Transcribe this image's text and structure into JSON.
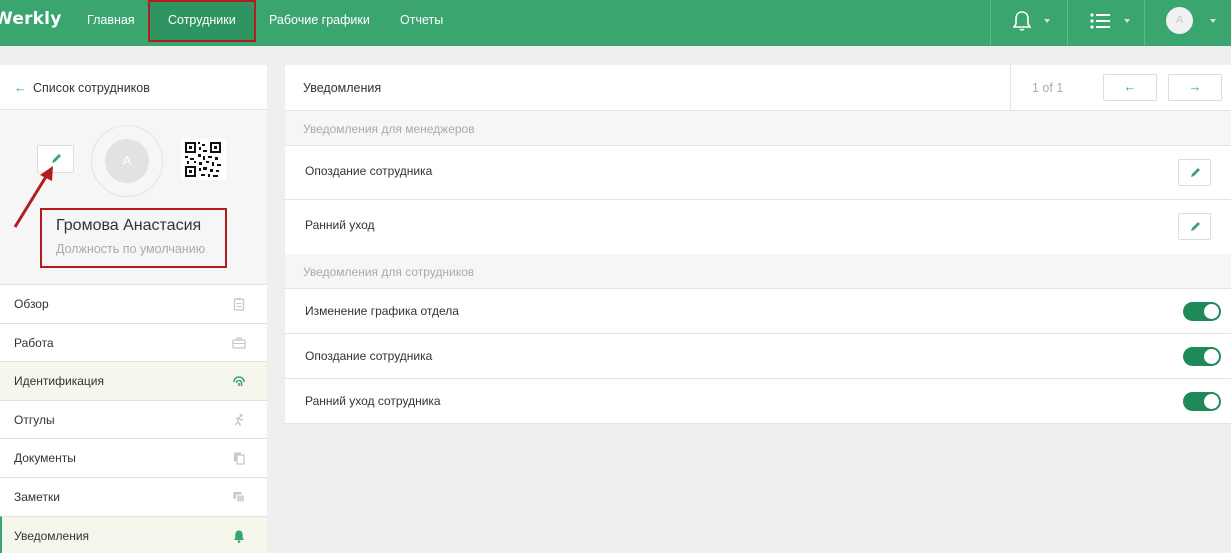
{
  "app": {
    "logo_text": "Werkly"
  },
  "nav": {
    "items": [
      {
        "label": "Главная"
      },
      {
        "label": "Сотрудники",
        "active": true
      },
      {
        "label": "Рабочие графики"
      },
      {
        "label": "Отчеты"
      }
    ]
  },
  "topbar": {
    "notifications_icon": "bell-icon",
    "list_icon": "list-icon",
    "avatar_letter": "A"
  },
  "sidebar": {
    "back_label": "Список сотрудников",
    "profile": {
      "avatar_letter": "А",
      "name": "Громова Анастасия",
      "position": "Должность по умолчанию"
    },
    "menu": [
      {
        "label": "Обзор",
        "icon": "clipboard-icon"
      },
      {
        "label": "Работа",
        "icon": "briefcase-icon"
      },
      {
        "label": "Идентификация",
        "icon": "fingerprint-icon",
        "highlighted": true
      },
      {
        "label": "Отгулы",
        "icon": "running-person-icon"
      },
      {
        "label": "Документы",
        "icon": "documents-icon"
      },
      {
        "label": "Заметки",
        "icon": "notes-icon"
      },
      {
        "label": "Уведомления",
        "icon": "bell-icon",
        "selected": true
      }
    ]
  },
  "main": {
    "title": "Уведомления",
    "pager": {
      "text": "1 of 1",
      "prev": "←",
      "next": "→"
    },
    "sections": [
      {
        "label": "Уведомления для менеджеров",
        "rows": [
          {
            "label": "Опоздание сотрудника",
            "control": "edit"
          },
          {
            "label": "Ранний уход",
            "control": "edit"
          }
        ]
      },
      {
        "label": "Уведомления для сотрудников",
        "rows": [
          {
            "label": "Изменение графика отдела",
            "control": "toggle",
            "on": true
          },
          {
            "label": "Опоздание сотрудника",
            "control": "toggle",
            "on": true
          },
          {
            "label": "Ранний уход сотрудника",
            "control": "toggle",
            "on": true
          }
        ]
      }
    ]
  },
  "colors": {
    "brand_green": "#3aa56f",
    "toggle_on": "#1e8a5a",
    "annotation_red": "#b51c1c"
  }
}
